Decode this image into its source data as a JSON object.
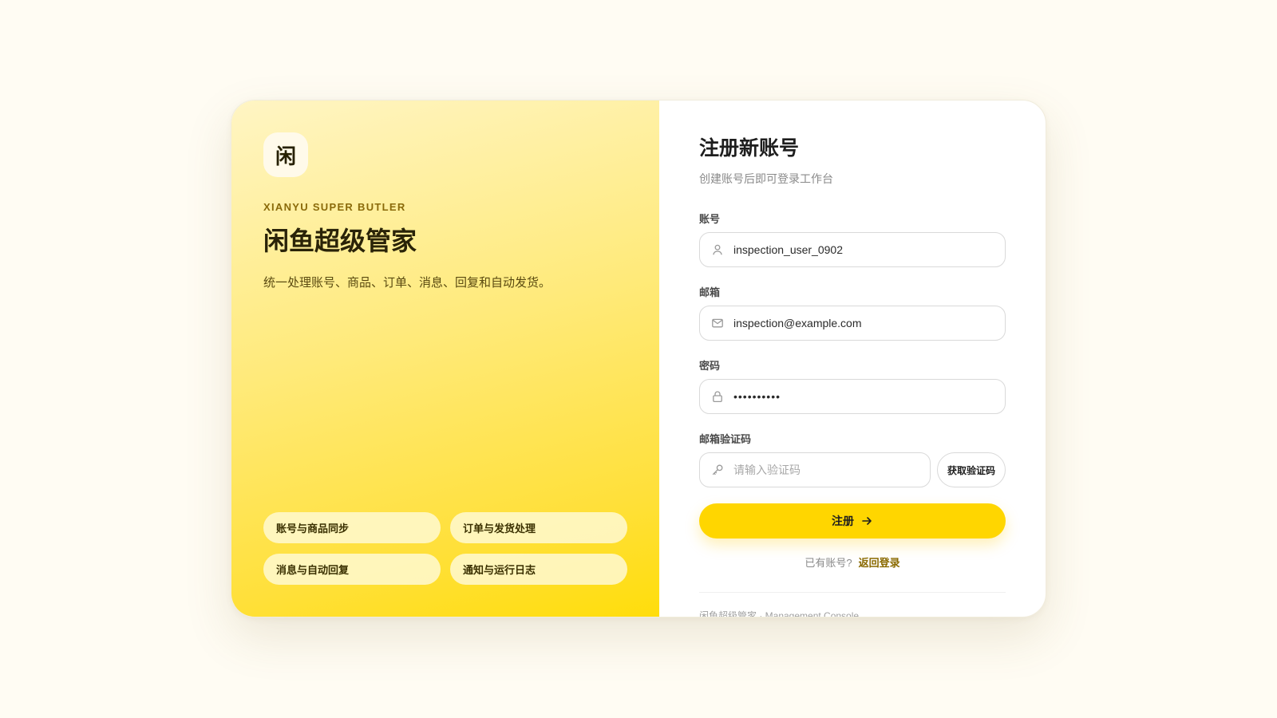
{
  "brand": {
    "logo_char": "闲",
    "eyebrow": "XIANYU SUPER BUTLER",
    "title": "闲鱼超级管家",
    "description": "统一处理账号、商品、订单、消息、回复和自动发货。",
    "features": [
      "账号与商品同步",
      "订单与发货处理",
      "消息与自动回复",
      "通知与运行日志"
    ]
  },
  "form": {
    "title": "注册新账号",
    "subtitle": "创建账号后即可登录工作台",
    "username": {
      "label": "账号",
      "value": "inspection_user_0902",
      "icon": "user-icon"
    },
    "email": {
      "label": "邮箱",
      "value": "inspection@example.com",
      "icon": "mail-icon"
    },
    "password": {
      "label": "密码",
      "value": "••••••••••",
      "icon": "lock-icon"
    },
    "code": {
      "label": "邮箱验证码",
      "placeholder": "请输入验证码",
      "value": "",
      "icon": "key-icon",
      "button_label": "获取验证码"
    },
    "submit_label": "注册",
    "submit_icon": "arrow-right-icon",
    "switch_prompt": "已有账号?",
    "switch_link": "返回登录",
    "footer": "闲鱼超级管家 · Management Console"
  },
  "colors": {
    "accent": "#ffd600",
    "page_bg": "#fffcf3",
    "link": "#8a6a00"
  }
}
